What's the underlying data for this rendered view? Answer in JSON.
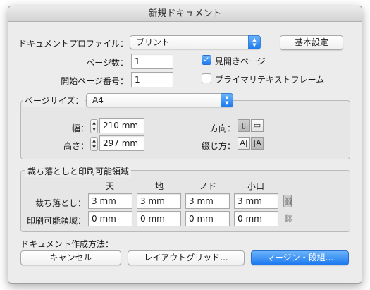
{
  "window": {
    "title": "新規ドキュメント"
  },
  "profile": {
    "label": "ドキュメントプロファイル：",
    "value": "プリント"
  },
  "basic_settings_button": "基本設定",
  "pages": {
    "label": "ページ数：",
    "value": "1"
  },
  "start_page": {
    "label": "開始ページ番号：",
    "value": "1"
  },
  "facing_pages": {
    "label": "見開きページ",
    "checked": true
  },
  "primary_text_frame": {
    "label": "プライマリテキストフレーム",
    "checked": false
  },
  "page_size": {
    "label": "ページサイズ：",
    "value": "A4",
    "width_label": "幅：",
    "width_value": "210 mm",
    "height_label": "高さ：",
    "height_value": "297 mm",
    "orientation_label": "方向：",
    "binding_label": "綴じ方："
  },
  "bleed_slug": {
    "legend": "裁ち落としと印刷可能領域",
    "columns": [
      "天",
      "地",
      "ノド",
      "小口"
    ],
    "bleed_label": "裁ち落とし：",
    "bleed_values": [
      "3 mm",
      "3 mm",
      "3 mm",
      "3 mm"
    ],
    "slug_label": "印刷可能領域：",
    "slug_values": [
      "0 mm",
      "0 mm",
      "0 mm",
      "0 mm"
    ]
  },
  "create_method_label": "ドキュメント作成方法：",
  "buttons": {
    "cancel": "キャンセル",
    "layout_grid": "レイアウトグリッド...",
    "margins_columns": "マージン・段組..."
  },
  "icons": {
    "select_arrows": "up-down-arrows-icon",
    "checkmark": "checkmark-icon",
    "stepper": "stepper-arrows-icon",
    "portrait": "portrait-orientation-icon",
    "landscape": "landscape-orientation-icon",
    "binding_left": "left-to-right-binding-icon",
    "binding_right": "right-to-left-binding-icon",
    "link": "chain-link-icon"
  },
  "colors": {
    "accent": "#1c7bf0",
    "panel": "#ececec"
  }
}
